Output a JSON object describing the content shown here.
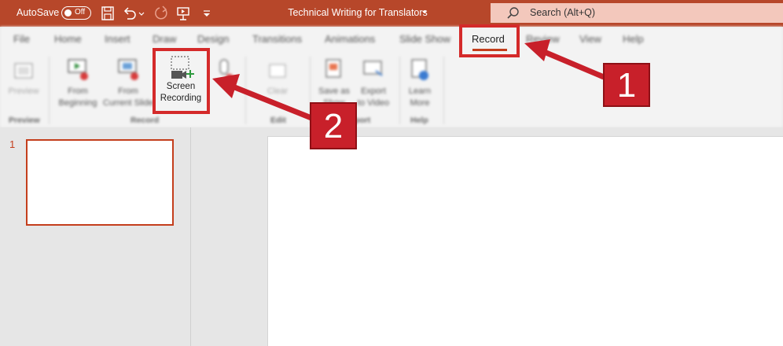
{
  "titlebar": {
    "autosave_label": "AutoSave",
    "autosave_state": "Off",
    "doc_title": "Technical Writing for Translators",
    "search_placeholder": "Search (Alt+Q)",
    "icons": [
      "save-icon",
      "undo-icon",
      "redo-icon",
      "present-icon",
      "customize-icon"
    ]
  },
  "ribbon": {
    "tabs": [
      "File",
      "Home",
      "Insert",
      "Draw",
      "Design",
      "Transitions",
      "Animations",
      "Slide Show",
      "Record",
      "Review",
      "View",
      "Help"
    ],
    "active_tab": "Record",
    "buttons": {
      "preview": "Preview",
      "from_beginning_1": "From",
      "from_beginning_2": "Beginning",
      "from_current_1": "From",
      "from_current_2": "Current Slide",
      "screen_recording_1": "Screen",
      "screen_recording_2": "Recording",
      "clear": "Clear",
      "save_as_1": "Save as",
      "save_as_2": "Show",
      "export_1": "Export",
      "export_2": "to Video",
      "learn_1": "Learn",
      "learn_2": "More"
    },
    "groups": {
      "preview": "Preview",
      "record": "Record",
      "edit": "Edit",
      "export": "Export",
      "help": "Help"
    }
  },
  "slides_pane": {
    "slide_number": "1"
  },
  "annotations": {
    "callout_1": "1",
    "callout_2": "2"
  },
  "colors": {
    "brand": "#b7472a",
    "accent": "#c43e1c",
    "annotation": "#c8202a"
  }
}
